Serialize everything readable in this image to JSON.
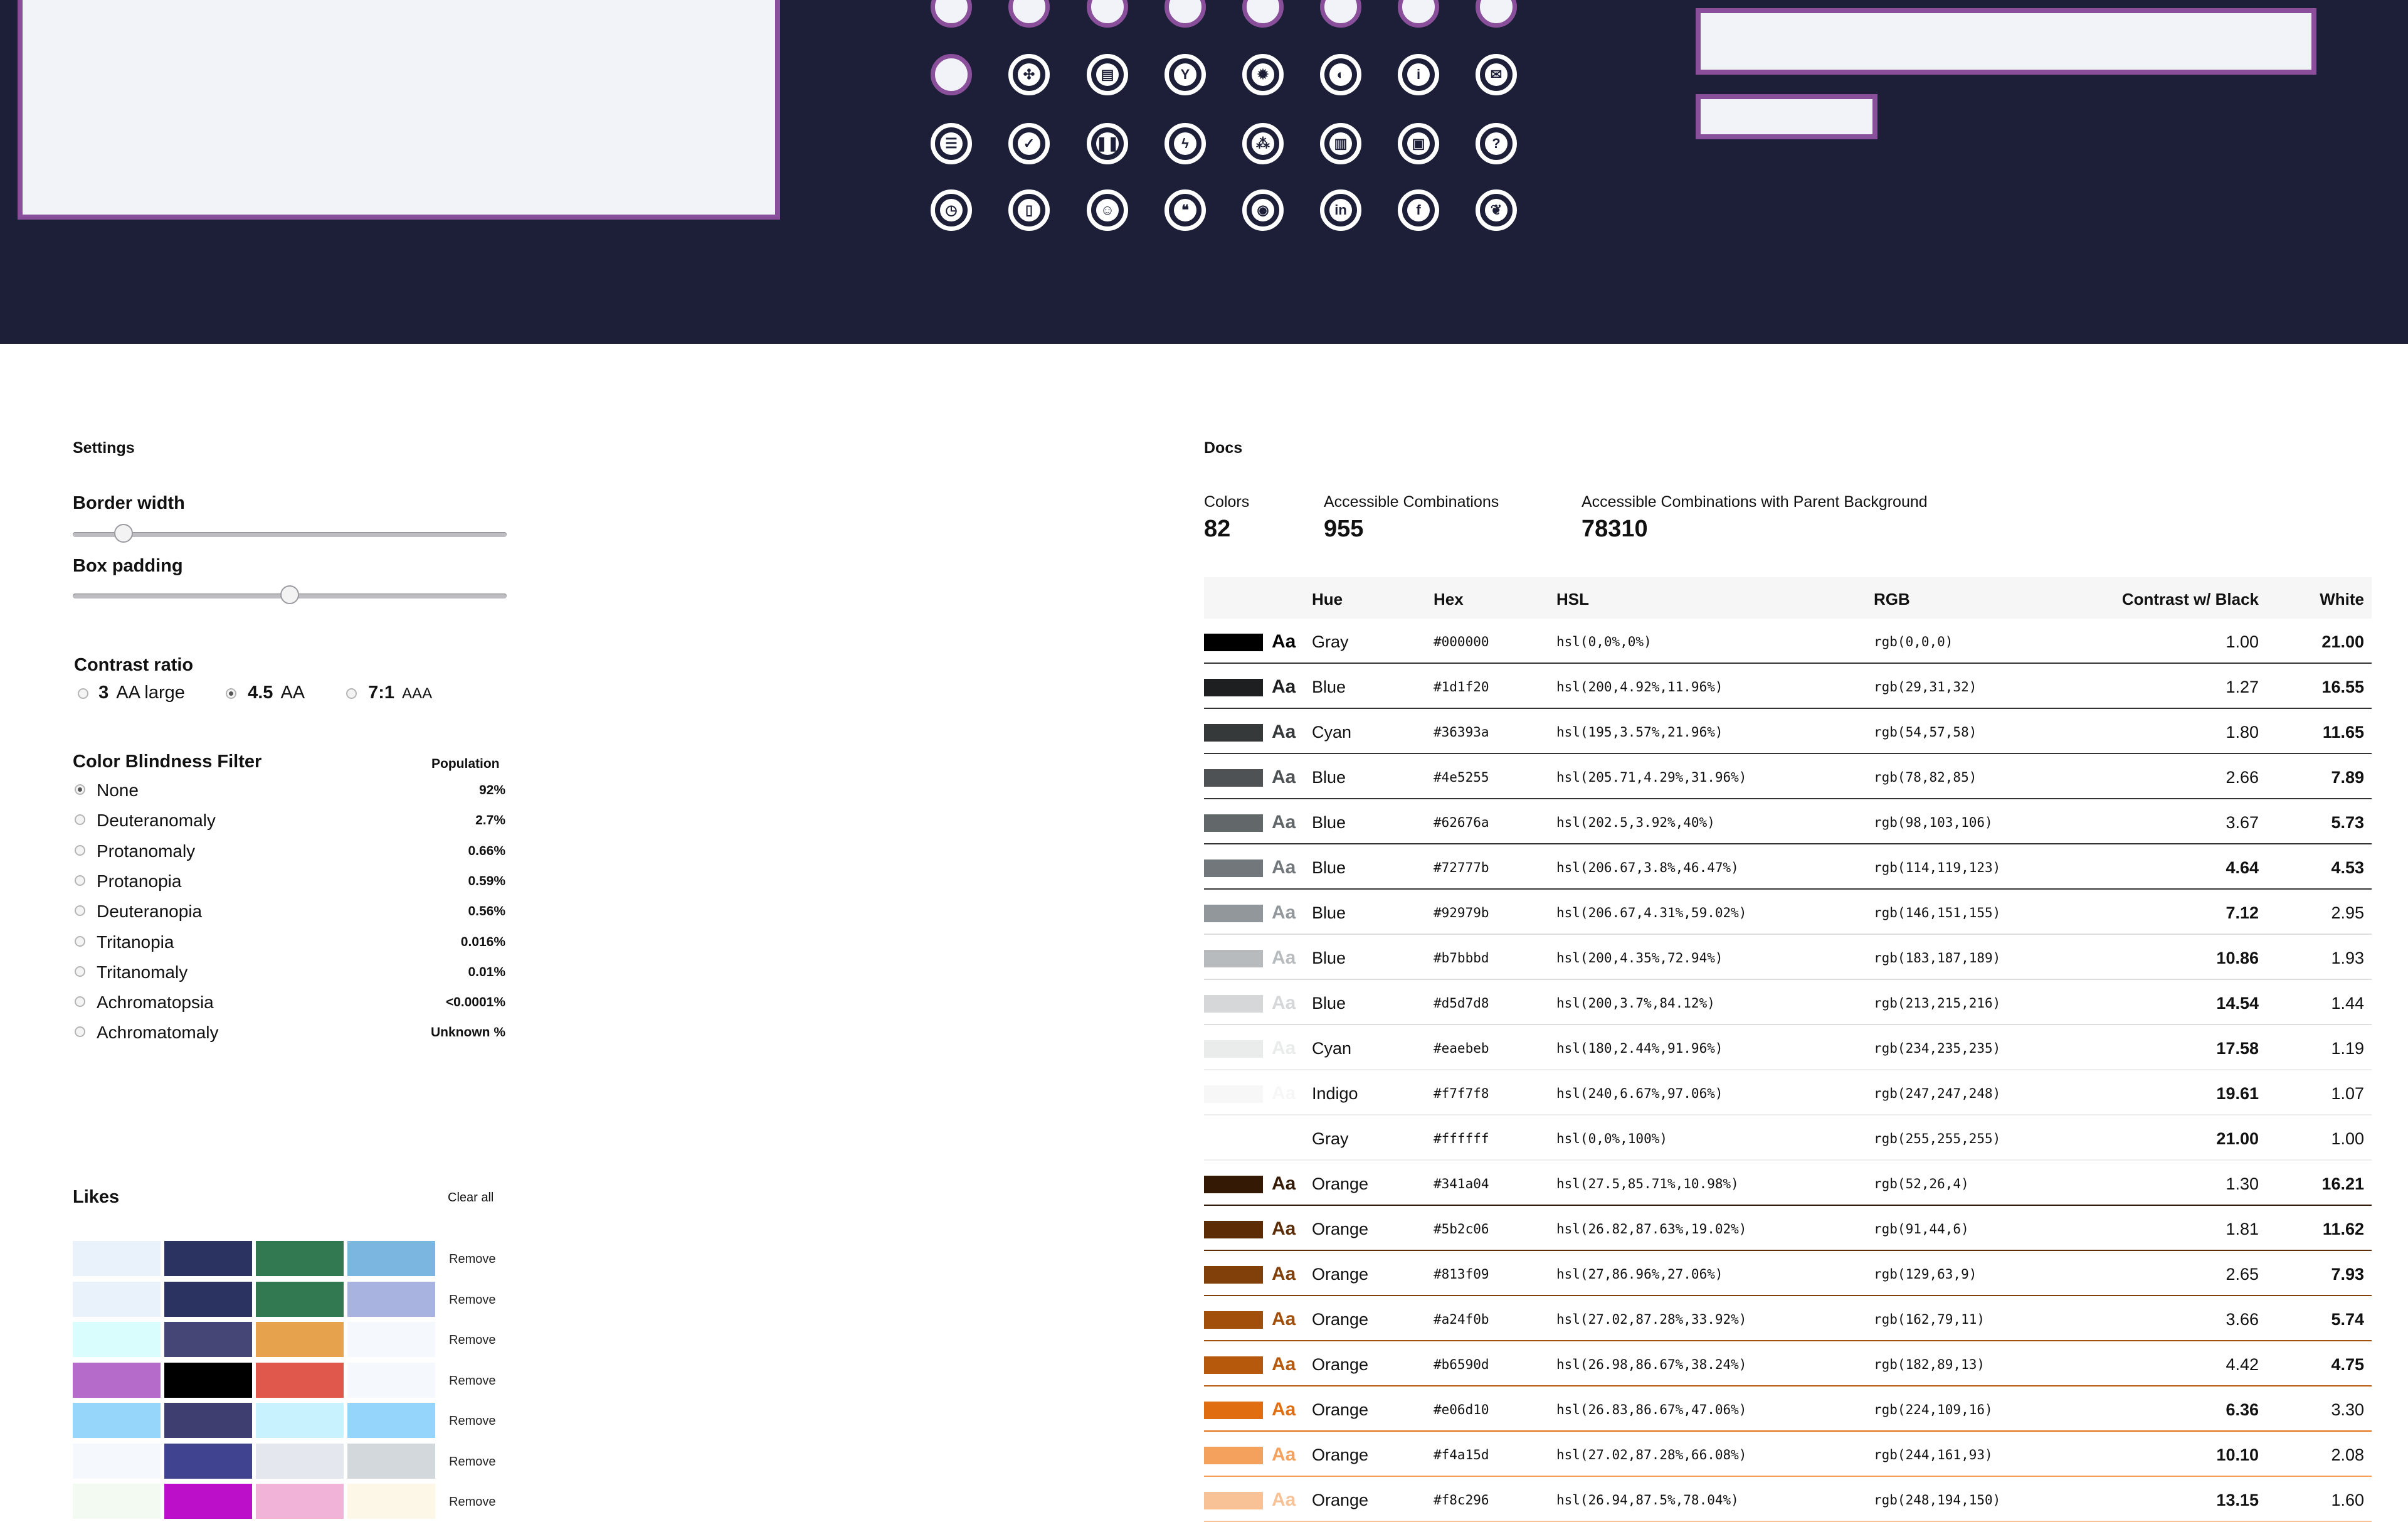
{
  "hero": {
    "icons_row_top": [
      "plain",
      "plain",
      "plain",
      "plain",
      "plain",
      "plain",
      "plain",
      "plain"
    ],
    "icons_row2": [
      "plain",
      "compress-icon",
      "file-icon",
      "filter-icon",
      "gear-icon",
      "shield-icon",
      "info-icon",
      "mail-icon"
    ],
    "icons_row3": [
      "list-icon",
      "check-icon",
      "pause-icon",
      "bolt-icon",
      "sitemap-icon",
      "clipboard-icon",
      "lock-icon",
      "question-icon"
    ],
    "icons_row4": [
      "clock-icon",
      "book-icon",
      "user-circle-icon",
      "quote-icon",
      "github-icon",
      "linkedin-icon",
      "facebook-icon",
      "twitter-icon"
    ],
    "glyphs": {
      "compress-icon": "✣",
      "file-icon": "▤",
      "filter-icon": "Y",
      "gear-icon": "✹",
      "shield-icon": "◐",
      "info-icon": "i",
      "mail-icon": "✉",
      "list-icon": "☰",
      "check-icon": "✓",
      "pause-icon": "❚❚",
      "bolt-icon": "ϟ",
      "sitemap-icon": "⁂",
      "clipboard-icon": "▥",
      "lock-icon": "▣",
      "question-icon": "?",
      "clock-icon": "◷",
      "book-icon": "▯",
      "user-circle-icon": "☺",
      "quote-icon": "❝",
      "github-icon": "◉",
      "linkedin-icon": "in",
      "facebook-icon": "f",
      "twitter-icon": "❦"
    },
    "accent": "#8a4f9a",
    "background": "#1c1f37"
  },
  "settings": {
    "title": "Settings",
    "border_width_label": "Border width",
    "border_width_value": 0.1,
    "box_padding_label": "Box padding",
    "box_padding_value": 0.5,
    "contrast_title": "Contrast ratio",
    "contrast_options": [
      {
        "value": "3",
        "desc": "AA large",
        "selected": false
      },
      {
        "value": "4.5",
        "desc": "AA",
        "selected": true
      },
      {
        "value": "7:1",
        "desc": "AAA",
        "selected": false
      }
    ],
    "cb_title": "Color Blindness Filter",
    "cb_population_header": "Population",
    "cb_options": [
      {
        "name": "None",
        "pct": "92%",
        "selected": true
      },
      {
        "name": "Deuteranomaly",
        "pct": "2.7%",
        "selected": false
      },
      {
        "name": "Protanomaly",
        "pct": "0.66%",
        "selected": false
      },
      {
        "name": "Protanopia",
        "pct": "0.59%",
        "selected": false
      },
      {
        "name": "Deuteranopia",
        "pct": "0.56%",
        "selected": false
      },
      {
        "name": "Tritanopia",
        "pct": "0.016%",
        "selected": false
      },
      {
        "name": "Tritanomaly",
        "pct": "0.01%",
        "selected": false
      },
      {
        "name": "Achromatopsia",
        "pct": "<0.0001%",
        "selected": false
      },
      {
        "name": "Achromatomaly",
        "pct": "Unknown %",
        "selected": false
      }
    ]
  },
  "likes": {
    "title": "Likes",
    "clear_label": "Clear all",
    "remove_label": "Remove",
    "rows": [
      [
        "#e9f2fb",
        "#2b3460",
        "#327850",
        "#7bb6e0"
      ],
      [
        "#e9f2fb",
        "#2b3460",
        "#327850",
        "#a8b4df"
      ],
      [
        "#d9fdfd",
        "#454576",
        "#e6a24d",
        "#f5f8fd"
      ],
      [
        "#b46bc9",
        "#000000",
        "#e0584c",
        "#f5f8fd"
      ],
      [
        "#97d6fb",
        "#3e3f70",
        "#c8f2fd",
        "#96d5fb"
      ],
      [
        "#f5f8fd",
        "#3f4390",
        "#e4e8ee",
        "#d3d8dd"
      ],
      [
        "#f2faf2",
        "#bb0fc9",
        "#f1b3d8",
        "#fcf7e6"
      ]
    ]
  },
  "docs": {
    "title": "Docs",
    "stats": [
      {
        "label": "Colors",
        "value": "82"
      },
      {
        "label": "Accessible Combinations",
        "value": "955"
      },
      {
        "label": "Accessible Combinations with Parent Background",
        "value": "78310"
      }
    ],
    "columns": {
      "hue": "Hue",
      "hex": "Hex",
      "hsl": "HSL",
      "rgb": "RGB",
      "black": "Contrast w/ Black",
      "white": "White"
    },
    "rows": [
      {
        "hex": "#000000",
        "hue": "Gray",
        "hsl": "hsl(0,0%,0%)",
        "rgb": "rgb(0,0,0)",
        "black": "1.00",
        "white": "21.00",
        "best": "white",
        "aa": "#ffffff",
        "line": "#333333"
      },
      {
        "hex": "#1d1f20",
        "hue": "Blue",
        "hsl": "hsl(200,4.92%,11.96%)",
        "rgb": "rgb(29,31,32)",
        "black": "1.27",
        "white": "16.55",
        "best": "white",
        "aa": "#1d1f20",
        "line": "#333333"
      },
      {
        "hex": "#36393a",
        "hue": "Cyan",
        "hsl": "hsl(195,3.57%,21.96%)",
        "rgb": "rgb(54,57,58)",
        "black": "1.80",
        "white": "11.65",
        "best": "white",
        "aa": "#36393a",
        "line": "#333333"
      },
      {
        "hex": "#4e5255",
        "hue": "Blue",
        "hsl": "hsl(205.71,4.29%,31.96%)",
        "rgb": "rgb(78,82,85)",
        "black": "2.66",
        "white": "7.89",
        "best": "white",
        "aa": "#4e5255",
        "line": "#333333"
      },
      {
        "hex": "#62676a",
        "hue": "Blue",
        "hsl": "hsl(202.5,3.92%,40%)",
        "rgb": "rgb(98,103,106)",
        "black": "3.67",
        "white": "5.73",
        "best": "white",
        "aa": "#62676a",
        "line": "#333333"
      },
      {
        "hex": "#72777b",
        "hue": "Blue",
        "hsl": "hsl(206.67,3.8%,46.47%)",
        "rgb": "rgb(114,119,123)",
        "black": "4.64",
        "white": "4.53",
        "best": "both",
        "aa": "#72777b",
        "line": "#333333"
      },
      {
        "hex": "#92979b",
        "hue": "Blue",
        "hsl": "hsl(206.67,4.31%,59.02%)",
        "rgb": "rgb(146,151,155)",
        "black": "7.12",
        "white": "2.95",
        "best": "black",
        "aa": "#92979b",
        "line": "#dddddd"
      },
      {
        "hex": "#b7bbbd",
        "hue": "Blue",
        "hsl": "hsl(200,4.35%,72.94%)",
        "rgb": "rgb(183,187,189)",
        "black": "10.86",
        "white": "1.93",
        "best": "black",
        "aa": "#b7bbbd",
        "line": "#dddddd"
      },
      {
        "hex": "#d5d7d8",
        "hue": "Blue",
        "hsl": "hsl(200,3.7%,84.12%)",
        "rgb": "rgb(213,215,216)",
        "black": "14.54",
        "white": "1.44",
        "best": "black",
        "aa": "#d5d7d8",
        "line": "#dddddd"
      },
      {
        "hex": "#eaebeb",
        "hue": "Cyan",
        "hsl": "hsl(180,2.44%,91.96%)",
        "rgb": "rgb(234,235,235)",
        "black": "17.58",
        "white": "1.19",
        "best": "black",
        "aa": "#eaebeb",
        "line": "#eeeeee"
      },
      {
        "hex": "#f7f7f8",
        "hue": "Indigo",
        "hsl": "hsl(240,6.67%,97.06%)",
        "rgb": "rgb(247,247,248)",
        "black": "19.61",
        "white": "1.07",
        "best": "black",
        "aa": "#f7f7f8",
        "line": "#eeeeee"
      },
      {
        "hex": "#ffffff",
        "hue": "Gray",
        "hsl": "hsl(0,0%,100%)",
        "rgb": "rgb(255,255,255)",
        "black": "21.00",
        "white": "1.00",
        "best": "black",
        "aa": "#ffffff",
        "line": "#eeeeee"
      },
      {
        "hex": "#341a04",
        "hue": "Orange",
        "hsl": "hsl(27.5,85.71%,10.98%)",
        "rgb": "rgb(52,26,4)",
        "black": "1.30",
        "white": "16.21",
        "best": "white",
        "aa": "#341a04",
        "line": "#341a04"
      },
      {
        "hex": "#5b2c06",
        "hue": "Orange",
        "hsl": "hsl(26.82,87.63%,19.02%)",
        "rgb": "rgb(91,44,6)",
        "black": "1.81",
        "white": "11.62",
        "best": "white",
        "aa": "#5b2c06",
        "line": "#5b2c06"
      },
      {
        "hex": "#813f09",
        "hue": "Orange",
        "hsl": "hsl(27,86.96%,27.06%)",
        "rgb": "rgb(129,63,9)",
        "black": "2.65",
        "white": "7.93",
        "best": "white",
        "aa": "#813f09",
        "line": "#813f09"
      },
      {
        "hex": "#a24f0b",
        "hue": "Orange",
        "hsl": "hsl(27.02,87.28%,33.92%)",
        "rgb": "rgb(162,79,11)",
        "black": "3.66",
        "white": "5.74",
        "best": "white",
        "aa": "#a24f0b",
        "line": "#a24f0b"
      },
      {
        "hex": "#b6590d",
        "hue": "Orange",
        "hsl": "hsl(26.98,86.67%,38.24%)",
        "rgb": "rgb(182,89,13)",
        "black": "4.42",
        "white": "4.75",
        "best": "white",
        "aa": "#b6590d",
        "line": "#b6590d"
      },
      {
        "hex": "#e06d10",
        "hue": "Orange",
        "hsl": "hsl(26.83,86.67%,47.06%)",
        "rgb": "rgb(224,109,16)",
        "black": "6.36",
        "white": "3.30",
        "best": "black",
        "aa": "#e06d10",
        "line": "#e06d10"
      },
      {
        "hex": "#f4a15d",
        "hue": "Orange",
        "hsl": "hsl(27.02,87.28%,66.08%)",
        "rgb": "rgb(244,161,93)",
        "black": "10.10",
        "white": "2.08",
        "best": "black",
        "aa": "#f4a15d",
        "line": "#f4a15d"
      },
      {
        "hex": "#f8c296",
        "hue": "Orange",
        "hsl": "hsl(26.94,87.5%,78.04%)",
        "rgb": "rgb(248,194,150)",
        "black": "13.15",
        "white": "1.60",
        "best": "black",
        "aa": "#f8c296",
        "line": "#f8c296"
      }
    ]
  }
}
